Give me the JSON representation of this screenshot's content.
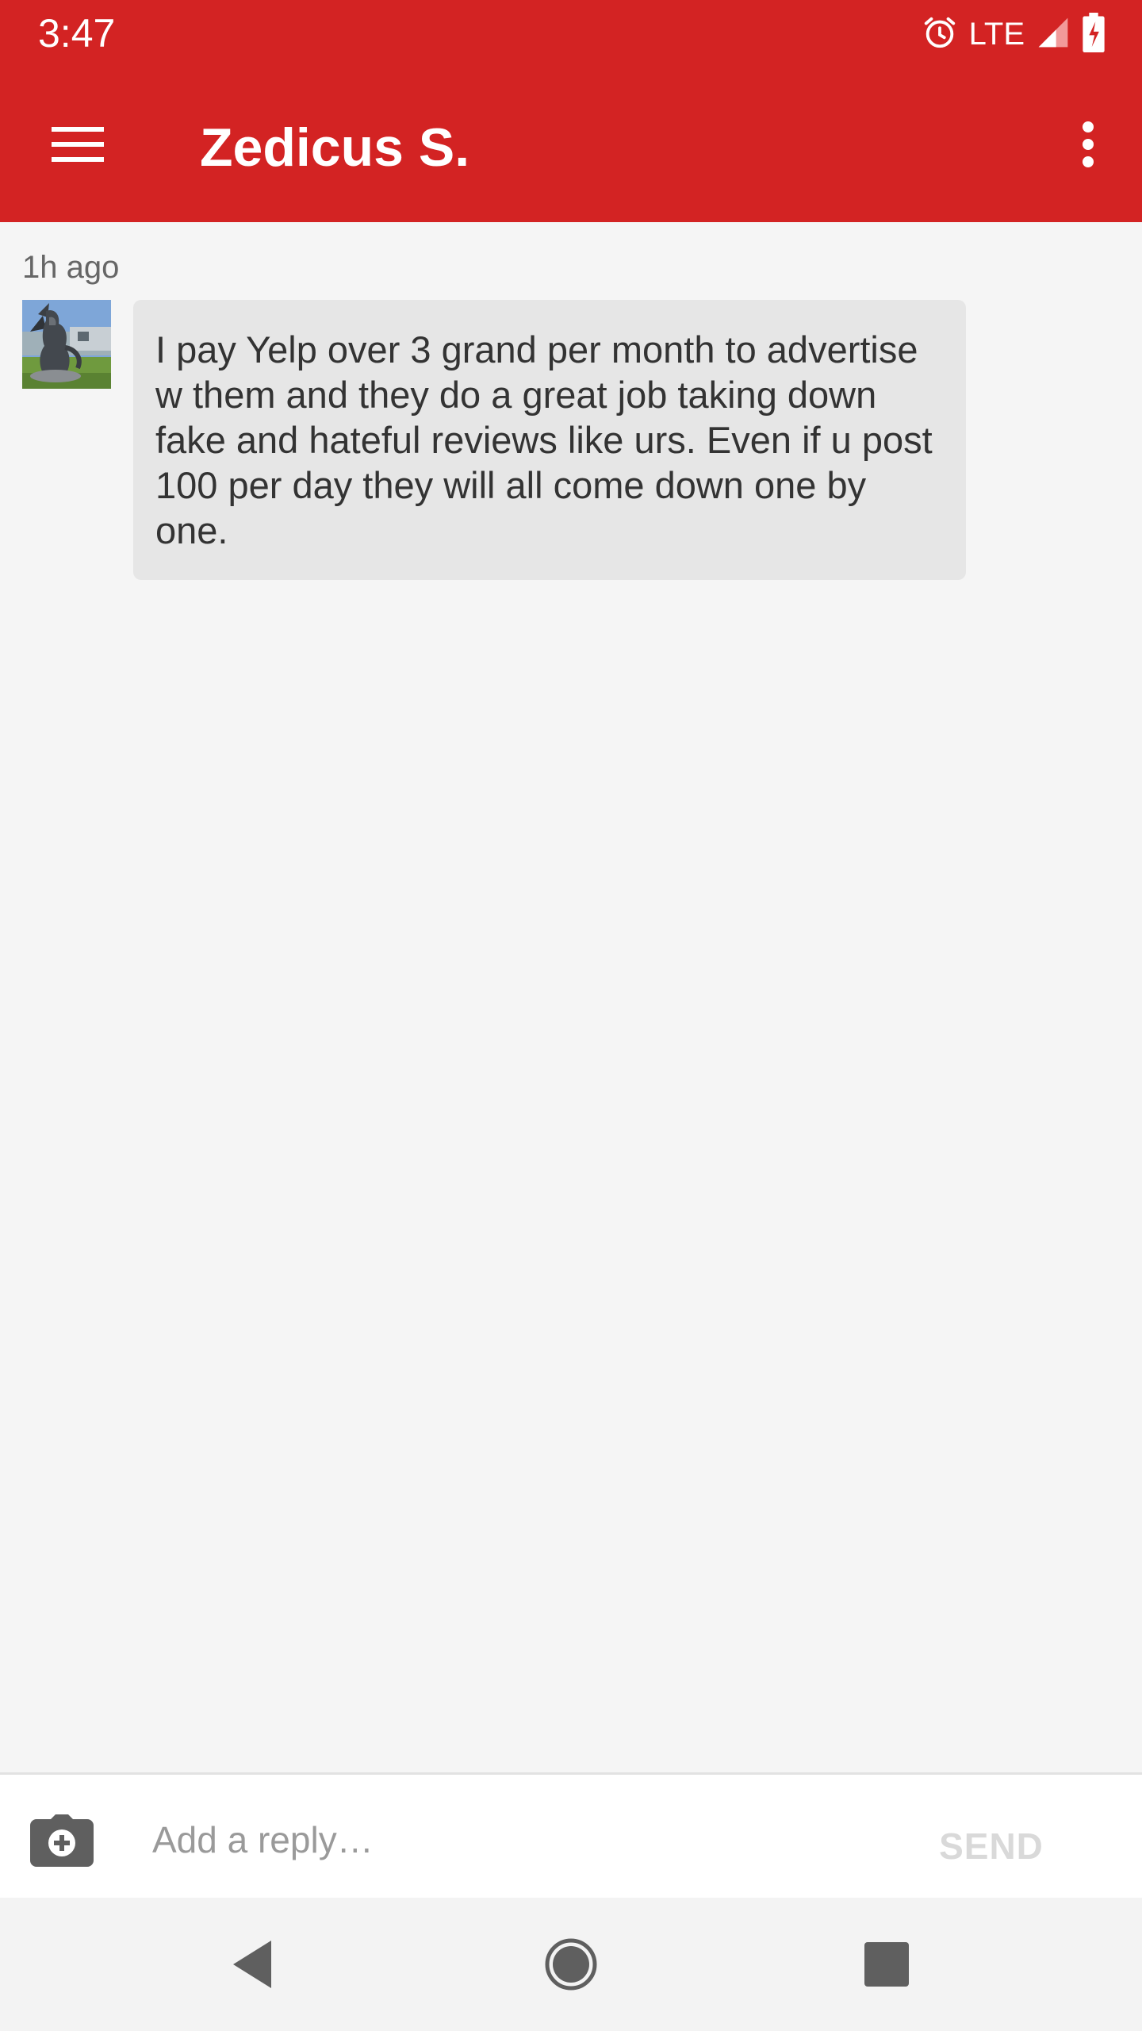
{
  "status_bar": {
    "time": "3:47",
    "network": "LTE",
    "icons": [
      "alarm-icon",
      "signal-icon",
      "battery-charging-icon"
    ]
  },
  "app_bar": {
    "title": "Zedicus S.",
    "menu_icon": "hamburger-menu-icon",
    "overflow_icon": "more-vert-icon",
    "background_color": "#d32323"
  },
  "conversation": {
    "messages": [
      {
        "timestamp": "1h ago",
        "avatar_icon": "gargoyle-statue-photo",
        "text": "I pay Yelp over 3 grand per month to advertise w them and they do a great job taking down fake and hateful reviews like urs. Even if u post 100 per day they will all come down one by one."
      }
    ]
  },
  "reply_bar": {
    "camera_icon": "add-photo-camera-icon",
    "placeholder": "Add a reply…",
    "value": "",
    "send_label": "SEND"
  },
  "nav_bar": {
    "icons": [
      "back-icon",
      "home-icon",
      "recents-icon"
    ]
  }
}
